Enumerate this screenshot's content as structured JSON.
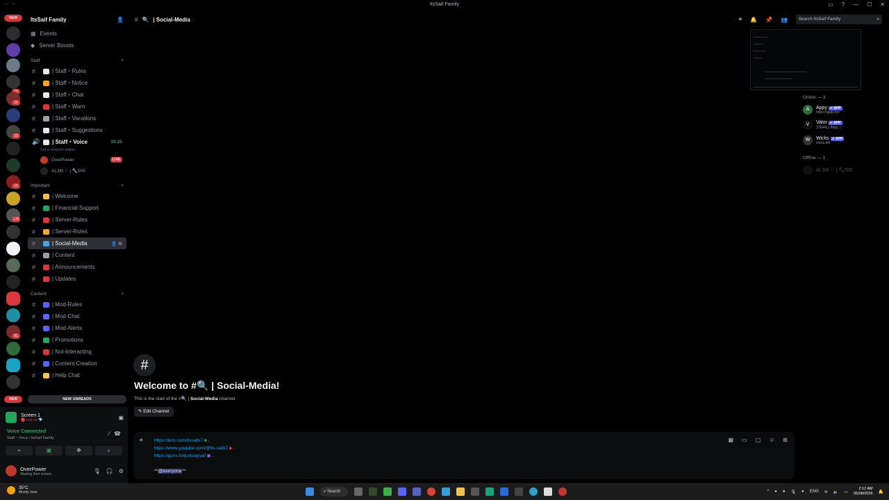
{
  "window": {
    "title": "ItsSaif Family"
  },
  "rail": {
    "new_badge": "NEW",
    "bottom_new_badge": "NEW",
    "counts": [
      "10",
      "22",
      "33",
      "21",
      "179",
      "81"
    ]
  },
  "guild": {
    "name": "ItsSaif Family"
  },
  "top_items": [
    {
      "label": "Events"
    },
    {
      "label": "Server Boosts"
    }
  ],
  "categories": {
    "staff": "Staff",
    "important": "Important",
    "content": "Content"
  },
  "staff_channels": [
    {
      "label": "| Staff・Rules",
      "color": "#e8e8e8"
    },
    {
      "label": "| Staff・Notice",
      "color": "#f5a623"
    },
    {
      "label": "| Staff・Chat",
      "color": "#e8e8e8"
    },
    {
      "label": "| Staff・Warn",
      "color": "#da373c"
    },
    {
      "label": "| Staff・Vacations",
      "color": "#9aa0a6"
    },
    {
      "label": "| Staff・Suggestions",
      "color": "#e8e8e8"
    }
  ],
  "voice_channel": {
    "label": "| Staff・Voice",
    "timer": "33:25",
    "status": "Set a channel status"
  },
  "voice_users": [
    {
      "name": "OverPower",
      "live": "LIVE"
    },
    {
      "name": "AL3M ♡ | 🔧505"
    }
  ],
  "important_channels": [
    {
      "label": "| Welcome",
      "color": "#f5c542"
    },
    {
      "label": "| Financial-Support",
      "color": "#23a55a"
    },
    {
      "label": "| Server-Rules",
      "color": "#da373c"
    },
    {
      "label": "| Server-Roles",
      "color": "#f5a623"
    },
    {
      "label": "| Social-Media",
      "color": "#4aa3df"
    },
    {
      "label": "| Content",
      "color": "#9aa0a6"
    },
    {
      "label": "| Announcements",
      "color": "#da373c"
    },
    {
      "label": "| Updates",
      "color": "#da373c"
    }
  ],
  "content_channels": [
    {
      "label": "| Mod-Rules",
      "color": "#5865f2"
    },
    {
      "label": "| Mod-Chat",
      "color": "#5865f2"
    },
    {
      "label": "| Mod-Alerts",
      "color": "#5865f2"
    },
    {
      "label": "| Promotions",
      "color": "#23a55a"
    },
    {
      "label": "| Not-Interacting",
      "color": "#da373c"
    },
    {
      "label": "| Content Creation",
      "color": "#5865f2"
    },
    {
      "label": "| Help Chat",
      "color": "#f5c542"
    }
  ],
  "new_unreads": "NEW UNREADS",
  "panel": {
    "screen_title": "Screen 1",
    "screen_sub": "🔴 Live on 💎",
    "voice_connected": "Voice Connected",
    "voice_location": "Staff・Voice / ItsSaif Family",
    "user_name": "OverPower",
    "user_status": "Sharing their screen"
  },
  "header": {
    "channel": "| Social-Media",
    "search_placeholder": "Search ItsSaif Family"
  },
  "welcome": {
    "title": "Welcome to #🔍 | Social-Media!",
    "sub_prefix": "This is the start of the #🔍 |",
    "sub_channel": "Social-Media",
    "sub_suffix": "channel.",
    "edit": "Edit Channel"
  },
  "composer": {
    "lines": [
      "https://kick.com/itssaifx7",
      "https://www.youtube.com/@its-saifx7",
      "https://guns.lol/justsaysaif"
    ],
    "mention_prefix": "**",
    "mention": "@everyone",
    "mention_suffix": "**"
  },
  "members": {
    "online_header": "Online — 3",
    "offline_header": "Offline — 1",
    "list": [
      {
        "name": "Appy",
        "sub": "https://appy.bot",
        "tag": "✔ APP",
        "initial": "A"
      },
      {
        "name": "Valor",
        "sub": "37844s | /help ⓘ",
        "tag": "✔ APP",
        "initial": "V"
      },
      {
        "name": "Wicks",
        "sub": "wicks.bot",
        "tag": "✔ APP",
        "initial": "W"
      }
    ],
    "offline": [
      {
        "name": "AL3M ♡ | 🔧505"
      }
    ]
  },
  "taskbar": {
    "temp": "35°C",
    "weather": "Mostly clear",
    "search": "Search",
    "lang": "ENG",
    "time": "2:12 AM",
    "date": "05/08/2026"
  }
}
